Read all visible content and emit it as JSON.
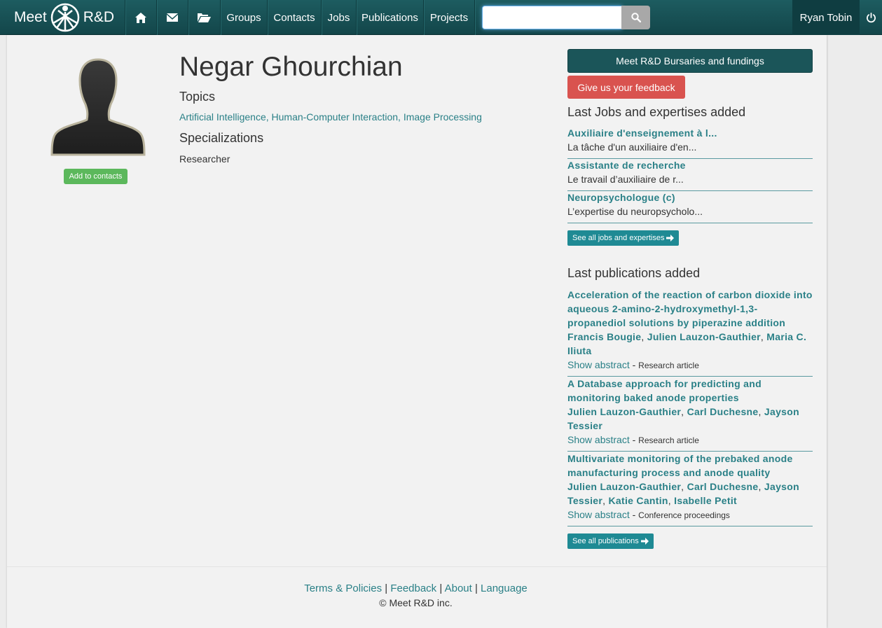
{
  "navbar": {
    "brand_left": "Meet",
    "brand_right": "R&D",
    "links": [
      "Groups",
      "Contacts",
      "Jobs",
      "Publications",
      "Projects"
    ],
    "search": {
      "value": "",
      "placeholder": ""
    },
    "user": "Ryan Tobin",
    "icons": [
      "home-icon",
      "envelope-icon",
      "folder-open-icon",
      "search-icon",
      "power-icon"
    ]
  },
  "profile": {
    "name": "Negar Ghourchian",
    "add_contact_label": "Add to contacts",
    "topics_heading": "Topics",
    "topics": [
      "Artificial Intelligence",
      "Human-Computer Interaction",
      "Image Processing"
    ],
    "topics_separator": ", ",
    "specializations_heading": "Specializations",
    "specialization": "Researcher"
  },
  "sidebar": {
    "bursaries_label": "Meet R&D Bursaries and fundings",
    "feedback_label": "Give us your feedback",
    "jobs_heading": "Last Jobs and expertises added",
    "jobs": [
      {
        "title": "Auxiliaire d'enseignement à l...",
        "desc": "La tâche d'un auxiliaire d'en..."
      },
      {
        "title": "Assistante de recherche",
        "desc": "Le travail d’auxiliaire de r..."
      },
      {
        "title": "Neuropsychologue (c)",
        "desc": "L’expertise du neuropsycholo..."
      }
    ],
    "see_all_jobs_label": "See all jobs and expertises",
    "pubs_heading": "Last publications added",
    "publications": [
      {
        "title": "Acceleration of the reaction of carbon dioxide into aqueous 2-amino-2-hydroxymethyl-1,3-propanediol solutions by piperazine addition",
        "authors": [
          "Francis Bougie",
          "Julien Lauzon-Gauthier",
          "Maria C. Iliuta"
        ],
        "show_abstract": "Show abstract",
        "type": "Research article"
      },
      {
        "title": "A Database approach for predicting and monitoring baked anode properties",
        "authors": [
          "Julien Lauzon-Gauthier",
          "Carl Duchesne",
          "Jayson Tessier"
        ],
        "show_abstract": "Show abstract",
        "type": "Research article"
      },
      {
        "title": "Multivariate monitoring of the prebaked anode manufacturing process and anode quality",
        "authors": [
          "Julien Lauzon-Gauthier",
          "Carl Duchesne",
          "Jayson Tessier",
          "Katie Cantin",
          "Isabelle Petit"
        ],
        "show_abstract": "Show abstract",
        "type": "Conference proceedings"
      }
    ],
    "see_all_pubs_label": "See all publications"
  },
  "footer": {
    "links": [
      "Terms & Policies",
      "Feedback",
      "About",
      "Language"
    ],
    "copyright": "© Meet R&D inc."
  },
  "colors": {
    "navbar": "#1d5c60",
    "link": "#2a8087",
    "success": "#5cb85c",
    "danger": "#d9534f",
    "info": "#1f8a94"
  }
}
